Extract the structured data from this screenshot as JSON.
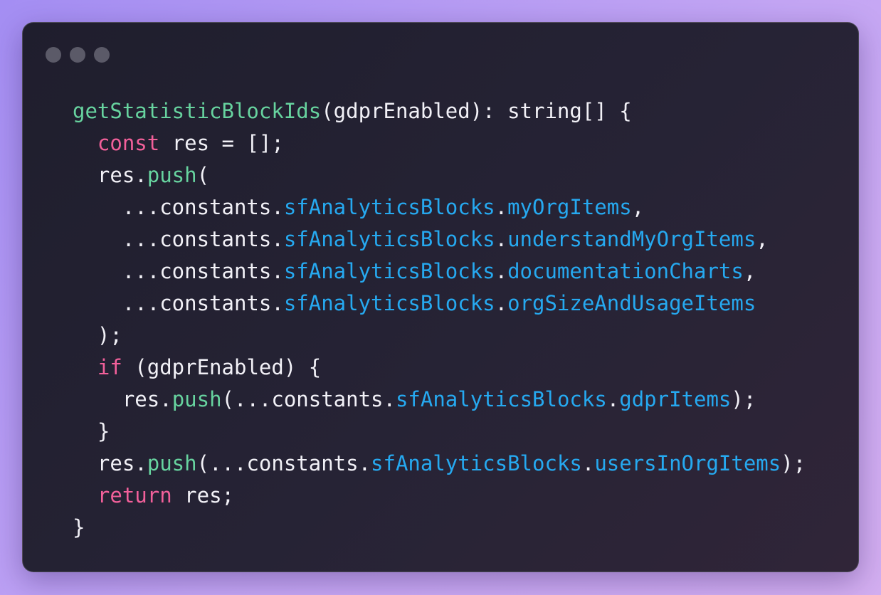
{
  "window": {
    "controls": [
      "close-dot",
      "minimize-dot",
      "maximize-dot"
    ]
  },
  "colors": {
    "function": "#67d39f",
    "keyword": "#f2609a",
    "property": "#26a9f0",
    "plain": "#f2f1f7"
  },
  "code": {
    "lines": [
      [
        {
          "t": "getStatisticBlockIds",
          "c": "fn"
        },
        {
          "t": "(gdprEnabled): string[] {",
          "c": "plain"
        }
      ],
      [
        {
          "t": "  ",
          "c": "plain"
        },
        {
          "t": "const",
          "c": "kw"
        },
        {
          "t": " res = [];",
          "c": "plain"
        }
      ],
      [
        {
          "t": "  res.",
          "c": "plain"
        },
        {
          "t": "push",
          "c": "fn"
        },
        {
          "t": "(",
          "c": "plain"
        }
      ],
      [
        {
          "t": "    ...constants.",
          "c": "plain"
        },
        {
          "t": "sfAnalyticsBlocks",
          "c": "prop"
        },
        {
          "t": ".",
          "c": "plain"
        },
        {
          "t": "myOrgItems",
          "c": "prop"
        },
        {
          "t": ",",
          "c": "plain"
        }
      ],
      [
        {
          "t": "    ...constants.",
          "c": "plain"
        },
        {
          "t": "sfAnalyticsBlocks",
          "c": "prop"
        },
        {
          "t": ".",
          "c": "plain"
        },
        {
          "t": "understandMyOrgItems",
          "c": "prop"
        },
        {
          "t": ",",
          "c": "plain"
        }
      ],
      [
        {
          "t": "    ...constants.",
          "c": "plain"
        },
        {
          "t": "sfAnalyticsBlocks",
          "c": "prop"
        },
        {
          "t": ".",
          "c": "plain"
        },
        {
          "t": "documentationCharts",
          "c": "prop"
        },
        {
          "t": ",",
          "c": "plain"
        }
      ],
      [
        {
          "t": "    ...constants.",
          "c": "plain"
        },
        {
          "t": "sfAnalyticsBlocks",
          "c": "prop"
        },
        {
          "t": ".",
          "c": "plain"
        },
        {
          "t": "orgSizeAndUsageItems",
          "c": "prop"
        }
      ],
      [
        {
          "t": "  );",
          "c": "plain"
        }
      ],
      [
        {
          "t": "  ",
          "c": "plain"
        },
        {
          "t": "if",
          "c": "kw"
        },
        {
          "t": " (gdprEnabled) {",
          "c": "plain"
        }
      ],
      [
        {
          "t": "    res.",
          "c": "plain"
        },
        {
          "t": "push",
          "c": "fn"
        },
        {
          "t": "(...constants.",
          "c": "plain"
        },
        {
          "t": "sfAnalyticsBlocks",
          "c": "prop"
        },
        {
          "t": ".",
          "c": "plain"
        },
        {
          "t": "gdprItems",
          "c": "prop"
        },
        {
          "t": ");",
          "c": "plain"
        }
      ],
      [
        {
          "t": "  }",
          "c": "plain"
        }
      ],
      [
        {
          "t": "  res.",
          "c": "plain"
        },
        {
          "t": "push",
          "c": "fn"
        },
        {
          "t": "(...constants.",
          "c": "plain"
        },
        {
          "t": "sfAnalyticsBlocks",
          "c": "prop"
        },
        {
          "t": ".",
          "c": "plain"
        },
        {
          "t": "usersInOrgItems",
          "c": "prop"
        },
        {
          "t": ");",
          "c": "plain"
        }
      ],
      [
        {
          "t": "  ",
          "c": "plain"
        },
        {
          "t": "return",
          "c": "kw"
        },
        {
          "t": " res;",
          "c": "plain"
        }
      ],
      [
        {
          "t": "}",
          "c": "plain"
        }
      ]
    ]
  }
}
